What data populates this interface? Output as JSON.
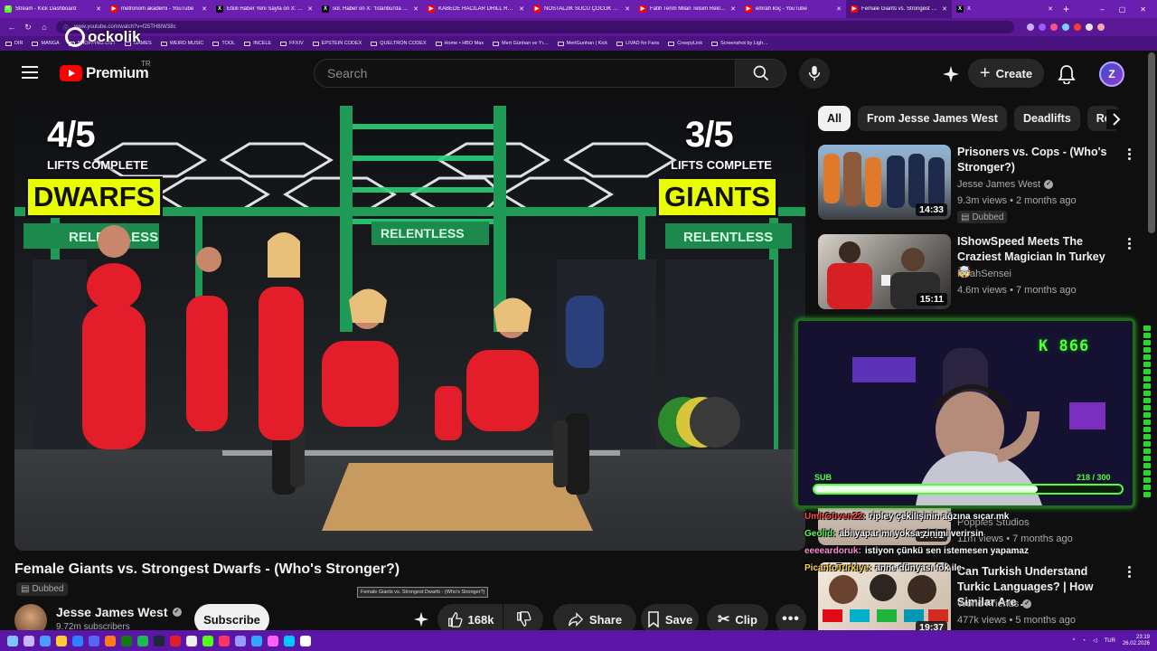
{
  "browser": {
    "tabs": [
      {
        "title": "Stream - Kick Dashboard",
        "icon_color": "#53fc18",
        "icon": "K"
      },
      {
        "title": "metronom akademi - YouTube",
        "icon_color": "#ff0000",
        "icon": "▶"
      },
      {
        "title": "Etkili Haber Yeni Sayfa on X: \"Mu…",
        "icon_color": "#000000",
        "icon": "X"
      },
      {
        "title": "sol. Haber on X: \"İstanbul'da orta…",
        "icon_color": "#000000",
        "icon": "X"
      },
      {
        "title": "KABEDE HACILAR DRILL REMIX(p…",
        "icon_color": "#ff0000",
        "icon": "▶"
      },
      {
        "title": "NOSTALJİK SUCU ÇOCUK 1995 R…",
        "icon_color": "#ff0000",
        "icon": "▶"
      },
      {
        "title": "Fatih Terim Milan Telsim Reklamı…",
        "icon_color": "#ff0000",
        "icon": "▶"
      },
      {
        "title": "emrah koç - YouTube",
        "icon_color": "#ff0000",
        "icon": "▶"
      },
      {
        "title": "Female Giants vs. Strongest D…",
        "icon_color": "#ff0000",
        "icon": "▶",
        "active": true
      },
      {
        "title": "X",
        "icon_color": "#000000",
        "icon": "X"
      }
    ],
    "new_tab": "+",
    "window_controls": [
      "–",
      "▢",
      "✕"
    ],
    "url": "www.youtube.com/watch?v=f25TH8IW38c",
    "bookmarks": [
      "DIR",
      "MANGA",
      "SHOPPING LIST",
      "GAMES",
      "WEIRD MUSIC",
      "TOOL",
      "INCELE",
      "FFXIV",
      "EPSTEIN CODEX",
      "QUELTRON CODEX",
      "Home • HBO Max",
      "Mert Günhan ve Yı…",
      "MertGunhan | Kick",
      "LIVAD for Fans",
      "CreepyLink",
      "Screenshot by Ligh…"
    ],
    "overlay_logo": "ockolik"
  },
  "header": {
    "region": "TR",
    "logo_text": "Premium",
    "search_placeholder": "Search",
    "create_label": "Create",
    "avatar_letter": "Z"
  },
  "video": {
    "overlay": {
      "left_count": "4/5",
      "left_sub": "LIFTS COMPLETE",
      "left_tag": "DWARFS",
      "right_count": "3/5",
      "right_sub": "LIFTS COMPLETE",
      "right_tag": "GIANTS",
      "gym_sign_1": "RELENTLESS",
      "gym_sign_2": "RELENTLESS",
      "gym_sign_3": "RELENTLESS"
    },
    "title": "Female Giants vs. Strongest Dwarfs - (Who's Stronger?)",
    "dubbed_label": "Dubbed",
    "tooltip": "Female Giants vs. Strongest Dwarfs - (Who's Stronger?)",
    "channel": {
      "name": "Jesse James West",
      "subscribers": "9.72m subscribers",
      "subscribe_label": "Subscribe"
    },
    "actions": {
      "likes": "168k",
      "share": "Share",
      "save": "Save",
      "clip": "Clip"
    }
  },
  "sidebar": {
    "chips": [
      "All",
      "From Jesse James West",
      "Deadlifts",
      "Re"
    ],
    "recommendations": [
      {
        "title": "Prisoners vs. Cops - (Who's Stronger?)",
        "channel": "Jesse James West",
        "verified": true,
        "meta": "9.3m views • 2 months ago",
        "duration": "14:33",
        "badge": "Dubbed"
      },
      {
        "title": "IShowSpeed Meets The Craziest Magician In Turkey 🤯",
        "channel": "NoahSensei",
        "verified": false,
        "meta": "4.6m views • 7 months ago",
        "duration": "15:11"
      },
      {
        "title": "",
        "channel": "Poppies Studios",
        "verified": false,
        "meta": "11m views • 7 months ago",
        "duration": "37:01"
      },
      {
        "title": "Can Turkish Understand Turkic Languages? | How Similar Are …",
        "channel": "World Friends",
        "verified": true,
        "meta": "477k views • 5 months ago",
        "duration": "19:37"
      }
    ]
  },
  "stream_overlay": {
    "kick_followers": "K 866",
    "sub_label": "SUB",
    "sub_progress": "218 / 300",
    "sub_fraction": 0.7267
  },
  "chat": [
    {
      "user": "UmitGüven22:",
      "user_color": "#ff4a4a",
      "msg": "ripley çekilişinin ağzına sıçar.mk"
    },
    {
      "user": "Geolid:",
      "user_color": "#57ff57",
      "msg": "abi yapar mı yoksa zinimi verirsin"
    },
    {
      "user": "eeeeardoruk:",
      "user_color": "#ff8bd6",
      "msg": "istiyon çünkü sen istemesen yapamaz"
    },
    {
      "user": "PicantoTurkiye:",
      "user_color": "#ffd84a",
      "msg": "anne dünyası fok ile"
    }
  ],
  "taskbar": {
    "lang": "TUR",
    "time": "23:19",
    "date": "26.02.2026"
  }
}
